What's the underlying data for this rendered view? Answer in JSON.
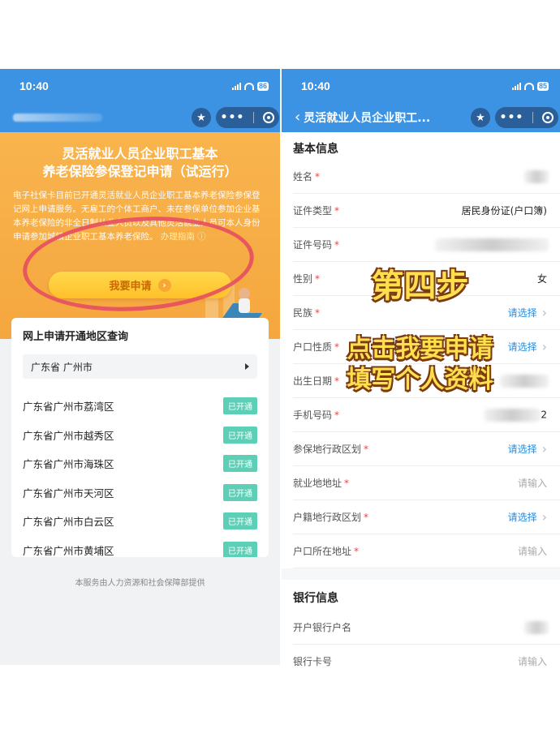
{
  "left": {
    "status": {
      "time": "10:40",
      "battery": "86"
    },
    "banner": {
      "title_line1": "灵活就业人员企业职工基本",
      "title_line2": "养老保险参保登记申请（试运行）",
      "body": "电子社保卡目前已开通灵活就业人员企业职工基本养老保险参保登记网上申请服务。无雇工的个体工商户、未在参保单位参加企业基本养老保险的非全日制从业人员以及其他灵活就业人员可本人身份申请参加城镇企业职工基本养老保险。",
      "guide_link": "办理指南",
      "apply_button": "我要申请"
    },
    "card": {
      "title": "网上申请开通地区查询",
      "city": "广东省 广州市",
      "districts": [
        {
          "name": "广东省广州市荔湾区",
          "status": "已开通"
        },
        {
          "name": "广东省广州市越秀区",
          "status": "已开通"
        },
        {
          "name": "广东省广州市海珠区",
          "status": "已开通"
        },
        {
          "name": "广东省广州市天河区",
          "status": "已开通"
        },
        {
          "name": "广东省广州市白云区",
          "status": "已开通"
        },
        {
          "name": "广东省广州市黄埔区",
          "status": "已开通"
        }
      ]
    },
    "footer": "本服务由人力资源和社会保障部提供"
  },
  "right": {
    "status": {
      "time": "10:40",
      "battery": "85"
    },
    "nav_title": "灵活就业人员企业职工...",
    "basic_section": "基本信息",
    "fields": {
      "name": "姓名",
      "id_type": "证件类型",
      "id_type_value": "居民身份证(户口簿)",
      "id_number": "证件号码",
      "gender": "性别",
      "gender_value": "女",
      "ethnicity": "民族",
      "hukou_type": "户口性质",
      "birth_date": "出生日期",
      "phone": "手机号码",
      "phone_tail": "2",
      "insured_region": "参保地行政区划",
      "work_address": "就业地地址",
      "hukou_region": "户籍地行政区划",
      "hukou_address": "户口所在地址"
    },
    "select_text": "请选择",
    "input_text": "请输入",
    "bank_section": "银行信息",
    "bank_fields": {
      "account_name": "开户银行户名",
      "card_number": "银行卡号"
    }
  },
  "overlay": {
    "step": "第四步",
    "line1": "点击我要申请",
    "line2": "填写个人资料"
  },
  "colors": {
    "primary_blue": "#3d93e3",
    "banner_orange": "#f5a73e",
    "open_badge": "#5ccfb6",
    "overlay_yellow": "#ffdf4d"
  }
}
